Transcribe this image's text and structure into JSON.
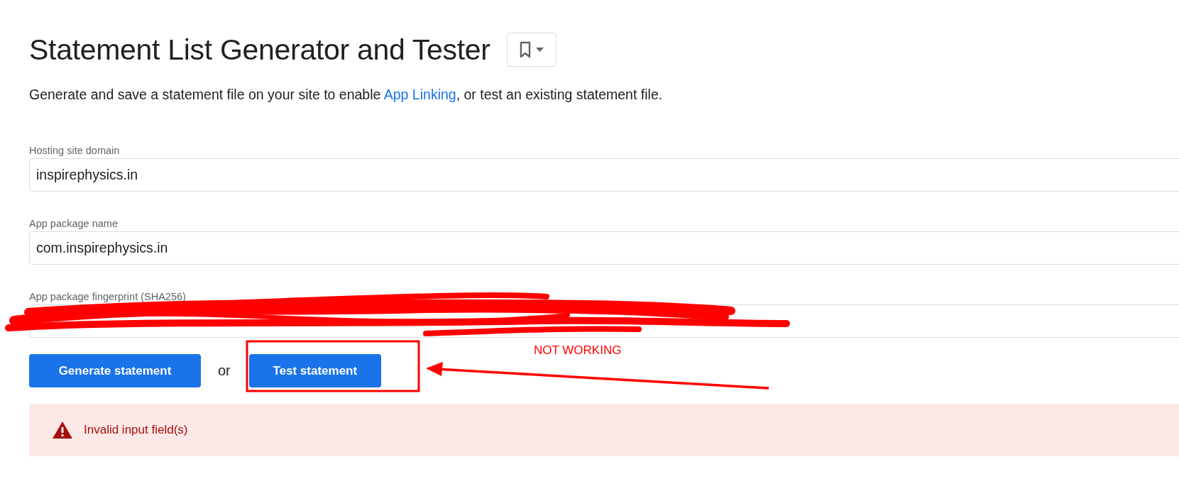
{
  "header": {
    "title": "Statement List Generator and Tester",
    "bookmark_button": {
      "kind": "bookmark"
    }
  },
  "description": {
    "before": "Generate and save a statement file on your site to enable ",
    "link": "App Linking",
    "after": ", or test an existing statement file."
  },
  "fields": [
    {
      "label": "Hosting site domain",
      "value": "inspirephysics.in"
    },
    {
      "label": "App package name",
      "value": "com.inspirephysics.in"
    },
    {
      "label": "App package fingerprint (SHA256)"
    }
  ],
  "actions": {
    "primary": "Generate statement",
    "separator": "or",
    "secondary": "Test statement"
  },
  "alert": {
    "kind": "error",
    "message": "Invalid input field(s)"
  },
  "annotation": {
    "note": "NOT WORKING"
  }
}
